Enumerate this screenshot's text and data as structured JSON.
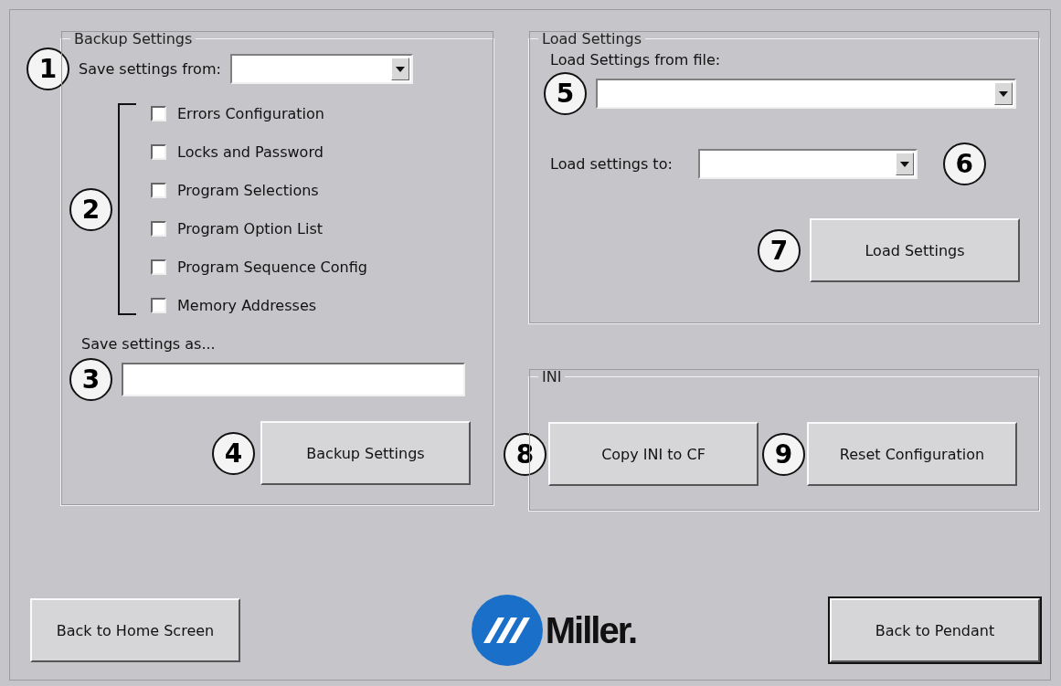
{
  "backup_settings": {
    "title": "Backup Settings",
    "save_from": {
      "callout": "1",
      "label": "Save settings from:"
    },
    "options_callout": "2",
    "options": [
      {
        "label": "Errors Configuration",
        "checked": false
      },
      {
        "label": "Locks and Password",
        "checked": false
      },
      {
        "label": "Program Selections",
        "checked": false
      },
      {
        "label": "Program Option List",
        "checked": false
      },
      {
        "label": "Program Sequence Config",
        "checked": false
      },
      {
        "label": "Memory Addresses",
        "checked": false
      }
    ],
    "save_as": {
      "label": "Save settings as...",
      "callout": "3"
    },
    "backup_button": {
      "callout": "4",
      "label": "Backup Settings"
    }
  },
  "load_settings": {
    "title": "Load Settings",
    "from_file": {
      "label": "Load Settings from file:",
      "callout": "5"
    },
    "load_to": {
      "label": "Load settings to:",
      "callout": "6"
    },
    "load_button": {
      "callout": "7",
      "label": "Load Settings"
    }
  },
  "ini": {
    "title": "INI",
    "buttons": [
      {
        "callout": "8",
        "label": "Copy INI to CF"
      },
      {
        "callout": "9",
        "label": "Reset Configuration"
      }
    ]
  },
  "footer": {
    "home_button": "Back to Home Screen",
    "logo": "Miller.",
    "pendant_button": "Back to Pendant"
  }
}
